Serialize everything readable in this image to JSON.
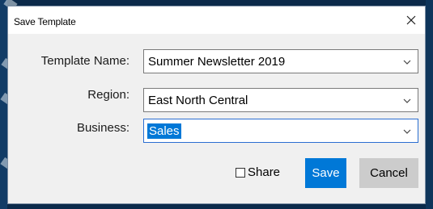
{
  "dialog": {
    "title": "Save Template",
    "close_icon": "close-icon"
  },
  "form": {
    "template_name": {
      "label": "Template Name:",
      "value": "Summer Newsletter 2019"
    },
    "region": {
      "label": "Region:",
      "value": "East North Central"
    },
    "business": {
      "label": "Business:",
      "value": "Sales"
    }
  },
  "actions": {
    "share_label": "Share",
    "share_checked": false,
    "save_label": "Save",
    "cancel_label": "Cancel"
  },
  "colors": {
    "accent": "#0078d7",
    "background": "#0b2a4a",
    "dialog_bg": "#f0f0f0"
  }
}
